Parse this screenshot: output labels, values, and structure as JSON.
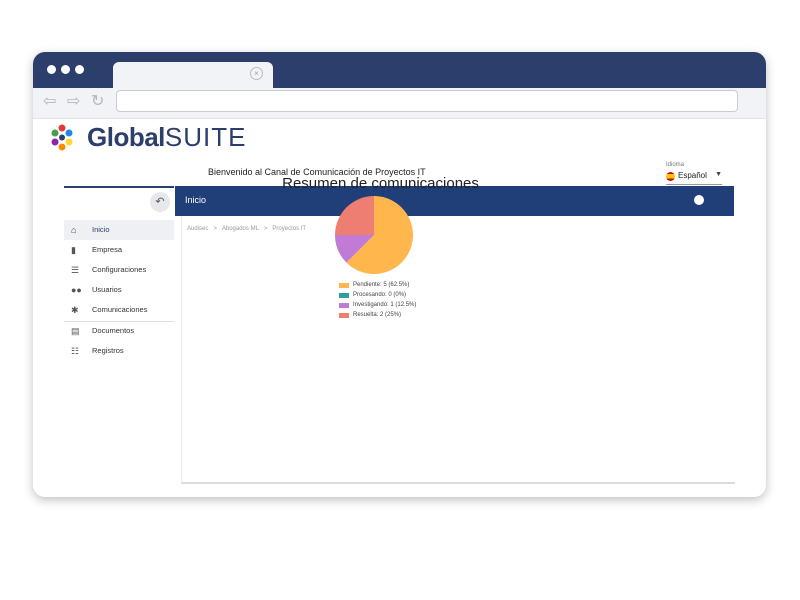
{
  "app": {
    "logo_text_bold": "Global",
    "logo_text_rest": "SUITE",
    "welcome": "Bienvenido al Canal de Comunicación de Proyectos IT"
  },
  "idioma": {
    "label": "Idioma",
    "value": "Español"
  },
  "sidebar": {
    "items": [
      {
        "label": "Inicio",
        "icon": "home-icon"
      },
      {
        "label": "Empresa",
        "icon": "building-icon"
      },
      {
        "label": "Configuraciones",
        "icon": "sliders-icon"
      },
      {
        "label": "Usuarios",
        "icon": "users-icon"
      },
      {
        "label": "Comunicaciones",
        "icon": "megaphone-icon"
      },
      {
        "label": "Documentos",
        "icon": "documents-icon"
      },
      {
        "label": "Registros",
        "icon": "list-icon"
      }
    ]
  },
  "header": {
    "title": "Inicio"
  },
  "breadcrumb": [
    "Audisec",
    "Abogados ML",
    "Proyectos IT"
  ],
  "chart_data": {
    "type": "pie",
    "title": "Resumen de comunicaciones",
    "categories": [
      "Pendiente",
      "Procesando",
      "Investigando",
      "Resuelta"
    ],
    "values": [
      5,
      0,
      1,
      2
    ],
    "legend": [
      "Pendiente: 5 (62.5%)",
      "Procesando: 0 (0%)",
      "Investigando: 1 (12.5%)",
      "Resuelta: 2 (25%)"
    ],
    "colors": [
      "#ffb64d",
      "#2aa198",
      "#c17bd4",
      "#ee7d72"
    ],
    "legend_position": "bottom"
  }
}
